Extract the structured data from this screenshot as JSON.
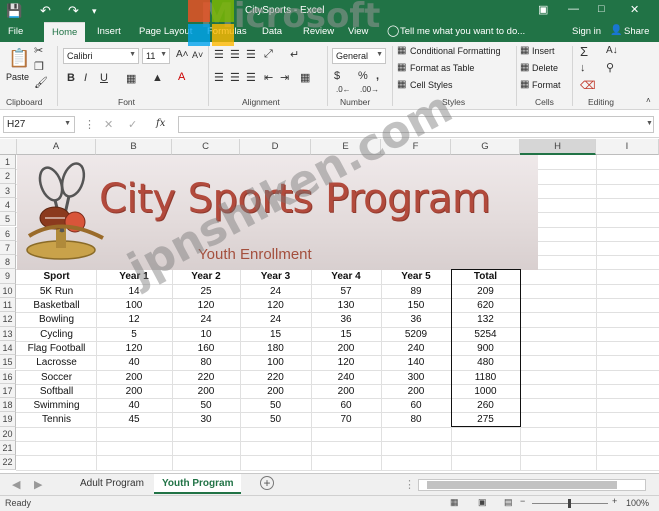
{
  "titlebar": {
    "title": "CitySports - Excel",
    "save_icon": "save-icon",
    "undo_icon": "undo-icon",
    "redo_icon": "redo-icon"
  },
  "tabs": [
    {
      "label": "File"
    },
    {
      "label": "Home"
    },
    {
      "label": "Insert"
    },
    {
      "label": "Page Layout"
    },
    {
      "label": "Formulas"
    },
    {
      "label": "Data"
    },
    {
      "label": "Review"
    },
    {
      "label": "View"
    }
  ],
  "tellme": "Tell me what you want to do...",
  "signin": "Sign in",
  "share": "Share",
  "ribbon": {
    "clipboard": {
      "label": "Clipboard",
      "paste": "Paste"
    },
    "font": {
      "label": "Font",
      "name": "Calibri",
      "size": "11"
    },
    "alignment": {
      "label": "Alignment"
    },
    "number": {
      "label": "Number",
      "format": "General"
    },
    "styles": {
      "label": "Styles",
      "conditional": "Conditional Formatting",
      "table": "Format as Table",
      "cell": "Cell Styles"
    },
    "cells": {
      "label": "Cells",
      "insert": "Insert",
      "delete": "Delete",
      "format": "Format"
    },
    "editing": {
      "label": "Editing"
    }
  },
  "namebox": "H27",
  "fx": "fx",
  "columns": [
    "A",
    "B",
    "C",
    "D",
    "E",
    "F",
    "G",
    "H",
    "I"
  ],
  "rows": [
    "1",
    "2",
    "3",
    "4",
    "5",
    "6",
    "7",
    "8",
    "9",
    "10",
    "11",
    "12",
    "13",
    "14",
    "15",
    "16",
    "17",
    "18",
    "19",
    "20",
    "21",
    "22"
  ],
  "banner": {
    "title": "City Sports Program",
    "subtitle": "Youth Enrollment"
  },
  "table": {
    "headers": [
      "Sport",
      "Year 1",
      "Year 2",
      "Year 3",
      "Year 4",
      "Year 5",
      "Total"
    ],
    "rows": [
      [
        "5K Run",
        "14",
        "25",
        "24",
        "57",
        "89",
        "209"
      ],
      [
        "Basketball",
        "100",
        "120",
        "120",
        "130",
        "150",
        "620"
      ],
      [
        "Bowling",
        "12",
        "24",
        "24",
        "36",
        "36",
        "132"
      ],
      [
        "Cycling",
        "5",
        "10",
        "15",
        "15",
        "5209",
        "5254"
      ],
      [
        "Flag Football",
        "120",
        "160",
        "180",
        "200",
        "240",
        "900"
      ],
      [
        "Lacrosse",
        "40",
        "80",
        "100",
        "120",
        "140",
        "480"
      ],
      [
        "Soccer",
        "200",
        "220",
        "220",
        "240",
        "300",
        "1180"
      ],
      [
        "Softball",
        "200",
        "200",
        "200",
        "200",
        "200",
        "1000"
      ],
      [
        "Swimming",
        "40",
        "50",
        "50",
        "60",
        "60",
        "260"
      ],
      [
        "Tennis",
        "45",
        "30",
        "50",
        "70",
        "80",
        "275"
      ]
    ]
  },
  "sheets": [
    {
      "label": "Adult Program"
    },
    {
      "label": "Youth Program"
    }
  ],
  "status": {
    "ready": "Ready",
    "zoom": "100%"
  },
  "watermark": {
    "brand": "Microsoft",
    "site": "jpnshiken.com"
  }
}
